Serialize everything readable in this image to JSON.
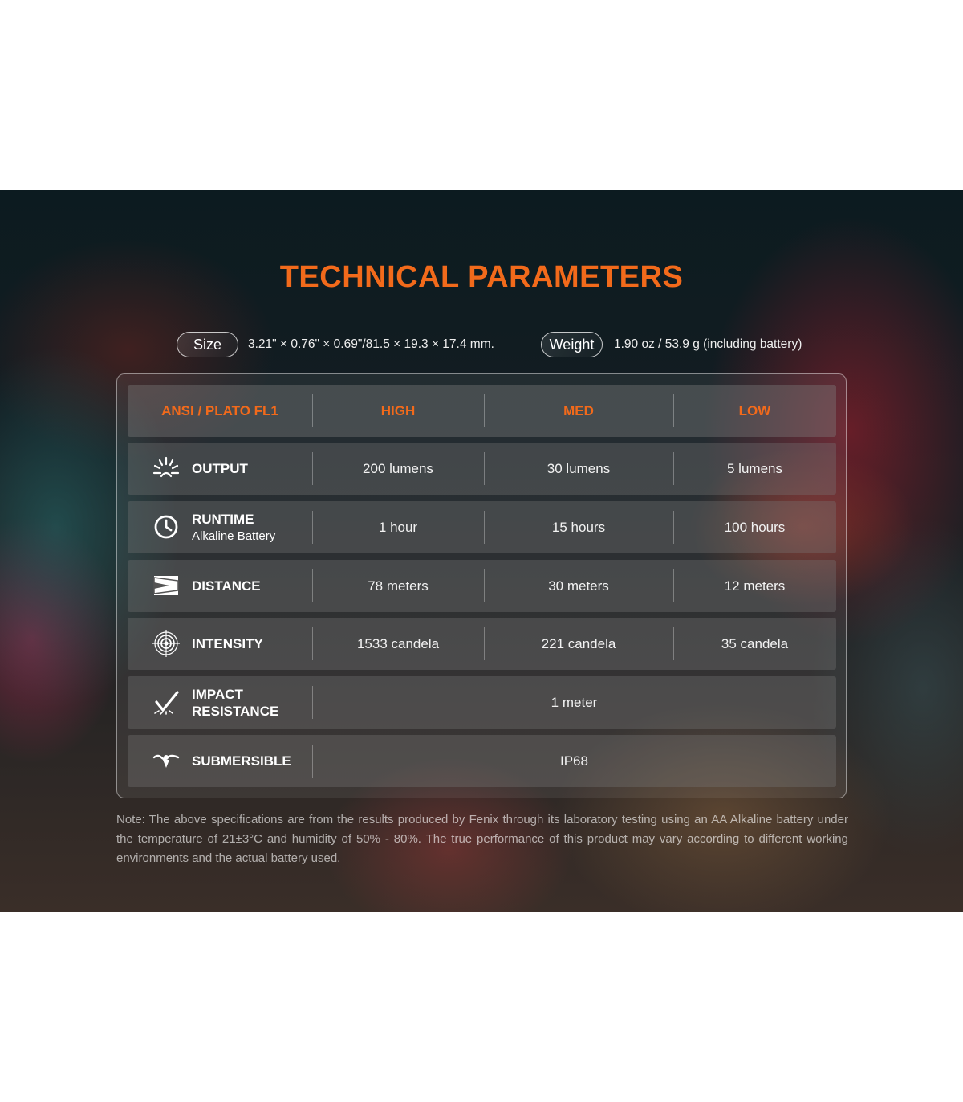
{
  "title": "TECHNICAL PARAMETERS",
  "size": {
    "label": "Size",
    "value": "3.21\" × 0.76\" × 0.69\"/81.5 × 19.3 × 17.4 mm."
  },
  "weight": {
    "label": "Weight",
    "value": "1.90 oz / 53.9 g (including battery)"
  },
  "table": {
    "header": {
      "standard": "ANSI / PLATO FL1",
      "high": "HIGH",
      "med": "MED",
      "low": "LOW"
    },
    "rows": [
      {
        "icon": "burst-icon",
        "label": "OUTPUT",
        "high": "200 lumens",
        "med": "30 lumens",
        "low": "5 lumens"
      },
      {
        "icon": "clock-icon",
        "label": "RUNTIME",
        "sublabel": "Alkaline Battery",
        "high": "1 hour",
        "med": "15 hours",
        "low": "100 hours"
      },
      {
        "icon": "distance-icon",
        "label": "DISTANCE",
        "high": "78 meters",
        "med": "30 meters",
        "low": "12 meters"
      },
      {
        "icon": "target-icon",
        "label": "INTENSITY",
        "high": "1533 candela",
        "med": "221 candela",
        "low": "35 candela"
      },
      {
        "icon": "impact-icon",
        "label": "IMPACT",
        "label2": "RESISTANCE",
        "value": "1 meter"
      },
      {
        "icon": "submersible-icon",
        "label": "SUBMERSIBLE",
        "value": "IP68"
      }
    ]
  },
  "note": "Note: The above specifications are from the results produced by Fenix through its laboratory testing using an AA Alkaline battery under the temperature of 21±3°C and humidity of 50% - 80%. The true performance of this product may vary according to different working environments and the actual battery used."
}
